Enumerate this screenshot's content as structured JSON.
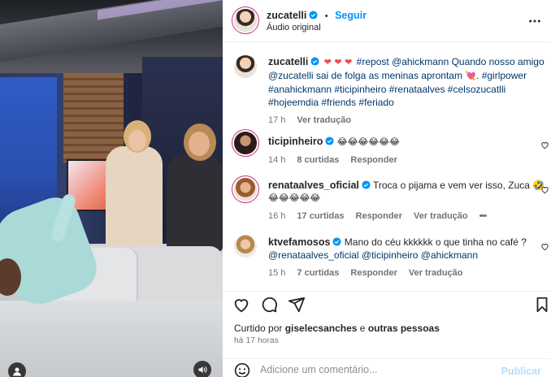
{
  "header": {
    "username": "zucatelli",
    "separator": "•",
    "follow_label": "Seguir",
    "subtitle": "Áudio original",
    "more_icon": "more-horizontal-icon"
  },
  "caption": {
    "username": "zucatelli",
    "hearts": "❤ ❤ ❤",
    "text_part1": "#repost @ahickmann Quando nosso amigo",
    "text_part2": "@zucatelli sai de folga as meninas aprontam",
    "emoji": "💘",
    "text_part3": ". #girlpower",
    "line3": "#anahickmann #ticipinheiro #renataalves #celsozucatlli",
    "line4": "#hojeemdia #friends #feriado",
    "time": "17 h",
    "translate": "Ver tradução"
  },
  "comments": [
    {
      "username": "ticipinheiro",
      "text": "😂😂😂😂😂😂",
      "time": "14 h",
      "likes": "8 curtidas",
      "reply": "Responder"
    },
    {
      "username": "renataalves_oficial",
      "text": "Troca o pijama e vem ver isso, Zuca 🤣",
      "text2": "😂😂😂😂😂",
      "time": "16 h",
      "likes": "17 curtidas",
      "reply": "Responder",
      "translate": "Ver tradução",
      "more": "•••"
    },
    {
      "username": "ktvefamosos",
      "text": "Mano do céu kkkkkk o que tinha no café ?",
      "text2": "@renataalves_oficial @ticipinheiro @ahickmann",
      "time": "15 h",
      "likes": "7 curtidas",
      "reply": "Responder",
      "translate": "Ver tradução"
    }
  ],
  "footer": {
    "liked_prefix": "Curtido por",
    "liked_user": "giselecsanches",
    "liked_suffix": "e",
    "liked_others": "outras pessoas",
    "posted_time": "há 17 horas",
    "comment_placeholder": "Adicione um comentário...",
    "publish_label": "Publicar"
  },
  "colors": {
    "link_blue": "#0095f6",
    "verified_blue": "#0095f6",
    "heart_red": "#ed4956",
    "muted": "#737373"
  }
}
